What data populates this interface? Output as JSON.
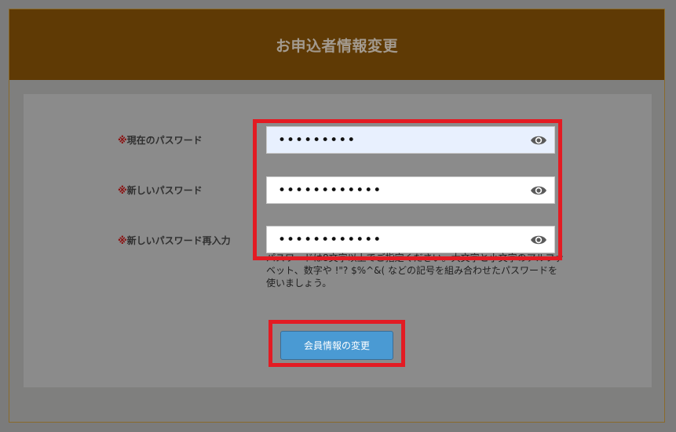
{
  "header": {
    "title": "お申込者情報変更"
  },
  "form": {
    "current_password": {
      "required_mark": "※",
      "label": "現在のパスワード",
      "value": "•••••••••",
      "icon": "eye-icon"
    },
    "new_password": {
      "required_mark": "※",
      "label": "新しいパスワード",
      "value": "••••••••••••",
      "icon": "eye-icon"
    },
    "confirm_password": {
      "required_mark": "※",
      "label": "新しいパスワード再入力",
      "value": "••••••••••••",
      "icon": "eye-icon"
    },
    "hint": "パスワードは8文字以上でご指定ください。大文字と小文字のアルファベット、数字や !\"? $%^&( などの記号を組み合わせたパスワードを使いましょう。",
    "submit_label": "会員情報の変更"
  },
  "colors": {
    "header_bg": "#5f3a05",
    "button_bg": "#4a9ad3",
    "highlight": "#e31b23",
    "required_mark": "#8c1010"
  }
}
